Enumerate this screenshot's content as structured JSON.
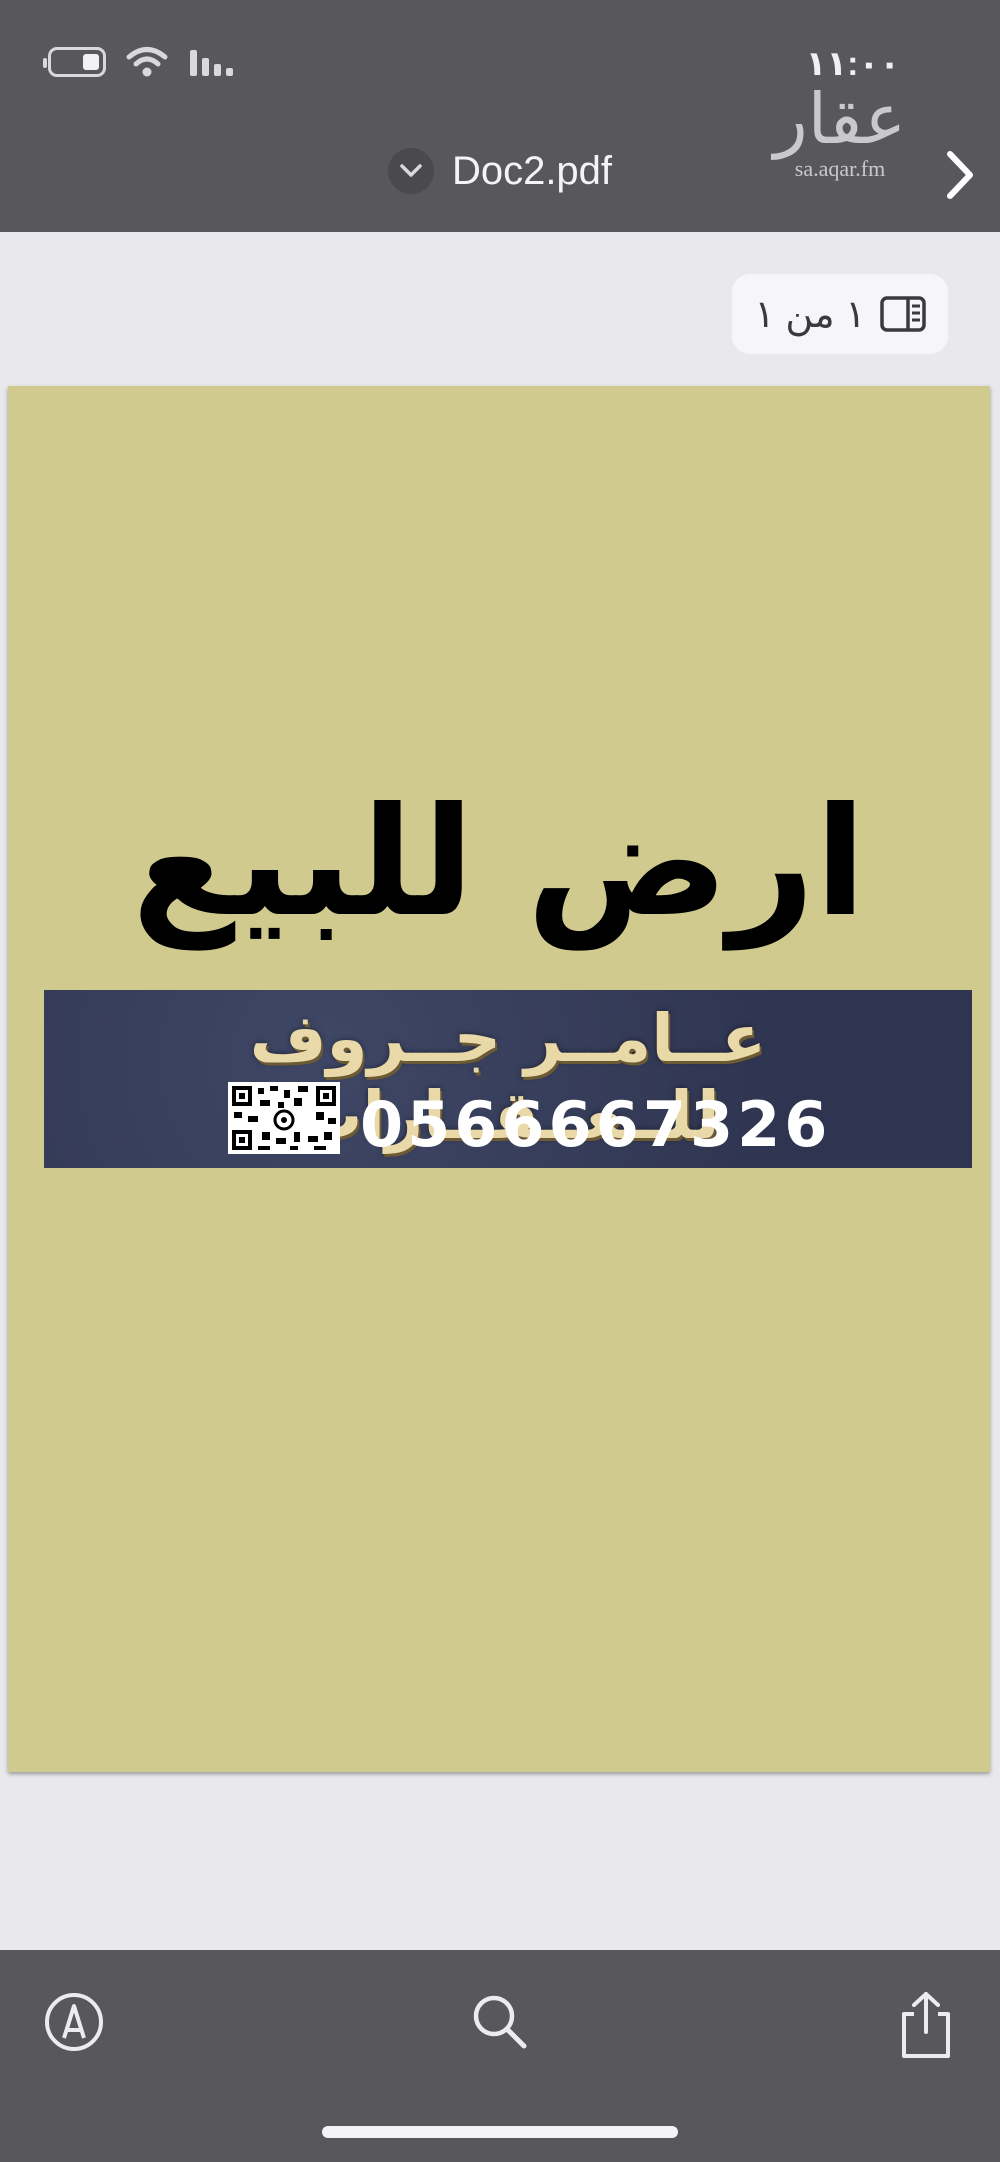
{
  "status_bar": {
    "time": "١١:٠٠"
  },
  "watermark": {
    "logo_text": "عقار",
    "url": "sa.aqar.fm"
  },
  "header": {
    "title": "Doc2.pdf"
  },
  "page_indicator": {
    "label": "١ من ١"
  },
  "pdf_page": {
    "headline": "ارض للبيع",
    "banner_name": "عــامــر جــروف للــعــقــارات",
    "banner_phone": "0566667326"
  },
  "toolbar": {
    "markup": "markup-icon",
    "search": "search-icon",
    "share": "share-icon"
  },
  "colors": {
    "bar_background": "#58585c",
    "page_background": "#d0ca8f",
    "banner_background": "#343b58",
    "banner_gold": "#e9d8a8"
  }
}
